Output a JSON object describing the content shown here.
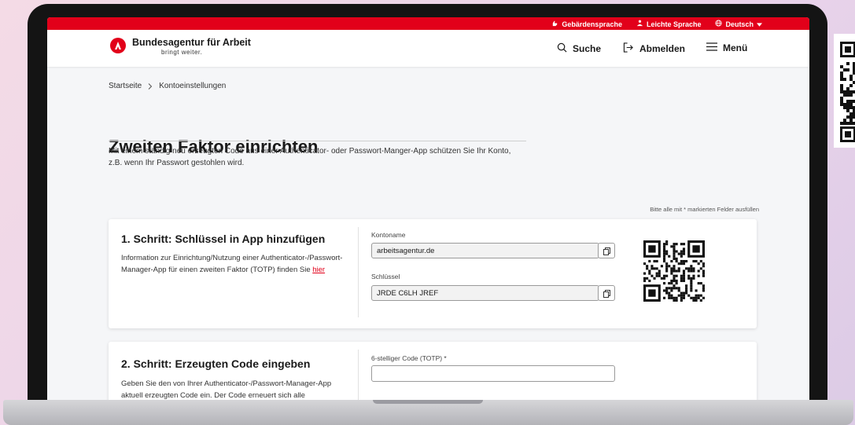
{
  "topbar": {
    "items": [
      {
        "label": "Gebärdensprache",
        "icon": "sign-language-icon"
      },
      {
        "label": "Leichte Sprache",
        "icon": "easy-language-icon"
      },
      {
        "label": "Deutsch",
        "icon": "globe-icon"
      }
    ]
  },
  "header": {
    "logo_title": "Bundesagentur für Arbeit",
    "logo_sub": "bringt weiter.",
    "search_label": "Suche",
    "logout_label": "Abmelden",
    "menu_label": "Menü"
  },
  "breadcrumb": {
    "home": "Startseite",
    "current": "Kontoeinstellungen"
  },
  "page": {
    "title": "Zweiten Faktor einrichten",
    "intro": "Mit einem ständig neu erzeugten Code aus einer Authenticator- oder Passwort-Manger-App schützen Sie Ihr Konto, z.B. wenn Ihr Passwort gestohlen wird.",
    "hint": "Bitte alle mit * markierten Felder ausfüllen"
  },
  "step1": {
    "title": "1. Schritt: Schlüssel in App hinzufügen",
    "text": "Information zur Einrichtung/Nutzung einer Authenticator-/Passwort-Manager-App für einen zweiten Faktor (TOTP) finden Sie ",
    "link": "hier",
    "account_label": "Kontoname",
    "account_value": "arbeitsagentur.de",
    "key_label": "Schlüssel",
    "key_value": "JRDE C6LH JREF"
  },
  "step2": {
    "title": "2. Schritt: Erzeugten Code eingeben",
    "text": "Geben Sie den von Ihrer Authenticator-/Passwort-Manager-App aktuell erzeugten Code ein. Der Code erneuert sich alle",
    "code_label": "6-stelliger Code (TOTP) *",
    "code_value": ""
  },
  "colors": {
    "brand_red": "#e2001a",
    "page_bg": "#f5f6f8"
  }
}
